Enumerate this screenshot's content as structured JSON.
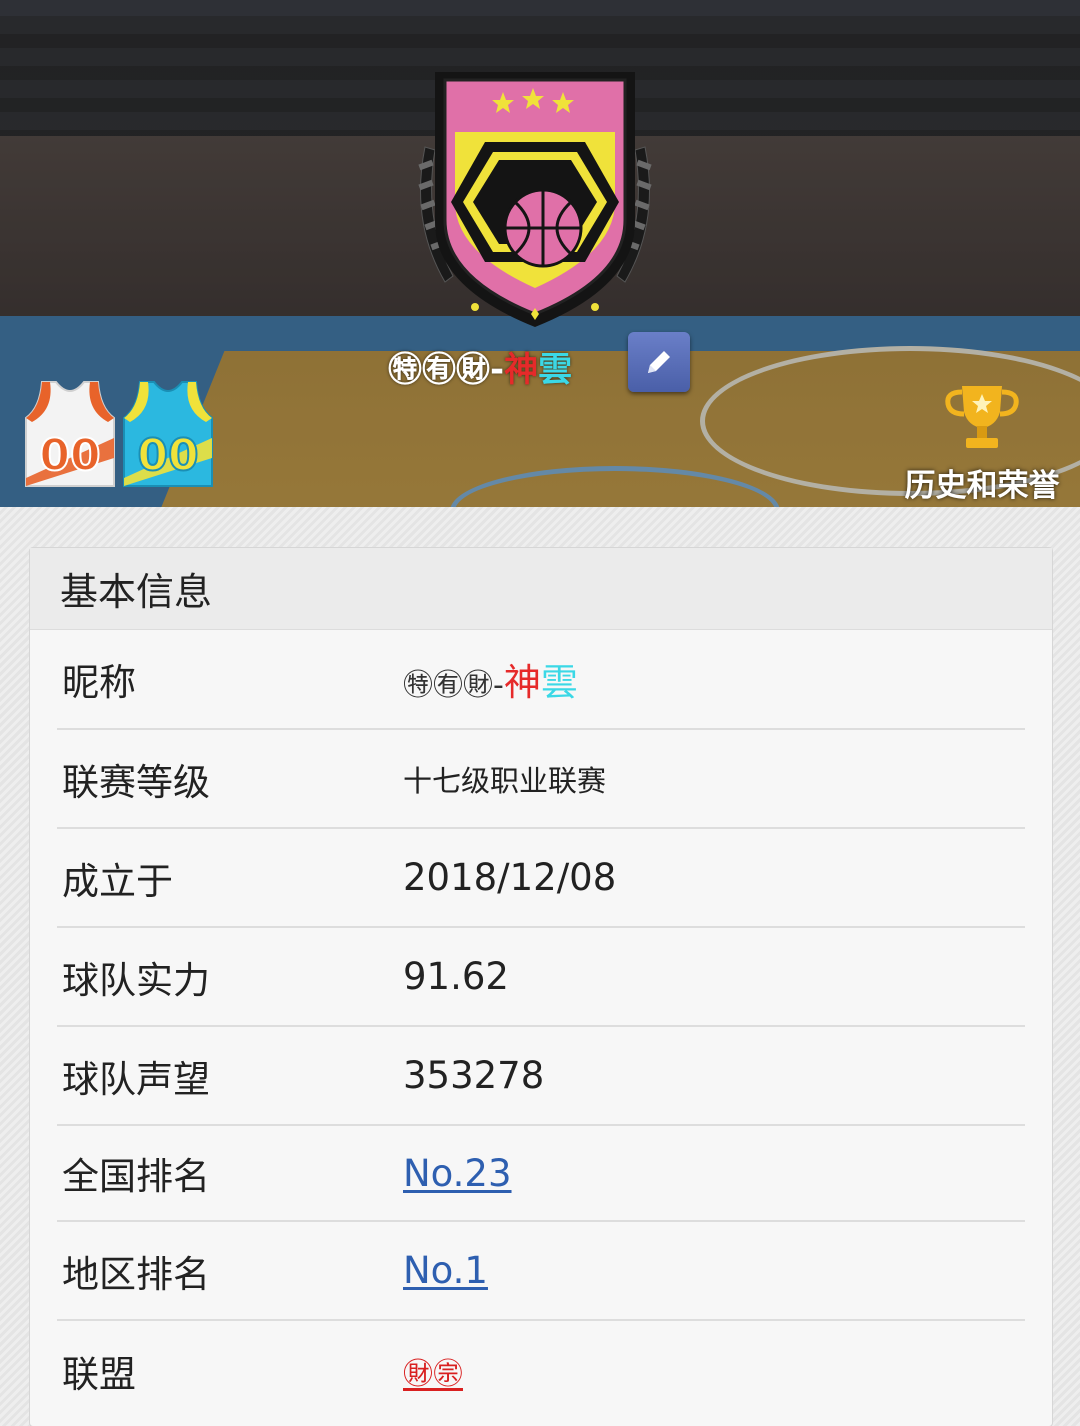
{
  "hero": {
    "team_name_part1": "㊕㊒㊖-",
    "team_name_part2": "神",
    "team_name_part3": "雲",
    "honor_label": "历史和荣誉",
    "jersey_home_number": "00",
    "jersey_away_number": "00",
    "colors": {
      "crest_pink": "#e070a8",
      "crest_yellow": "#f0e23a",
      "jersey_home_accent": "#e8632a",
      "jersey_away_body": "#2bb8e0",
      "jersey_away_accent": "#f0e23a",
      "edit_button": "#5a6fb8"
    }
  },
  "info": {
    "title": "基本信息",
    "rows": [
      {
        "key": "昵称",
        "value_part1": "㊕㊒㊖-",
        "value_part2": "神",
        "value_part3": "雲"
      },
      {
        "key": "联赛等级",
        "value": "十七级职业联赛"
      },
      {
        "key": "成立于",
        "value": "2018/12/08"
      },
      {
        "key": "球队实力",
        "value": "91.62"
      },
      {
        "key": "球队声望",
        "value": "353278"
      },
      {
        "key": "全国排名",
        "value": "No.23"
      },
      {
        "key": "地区排名",
        "value": "No.1"
      },
      {
        "key": "联盟",
        "value": "㊖㊪"
      }
    ]
  }
}
